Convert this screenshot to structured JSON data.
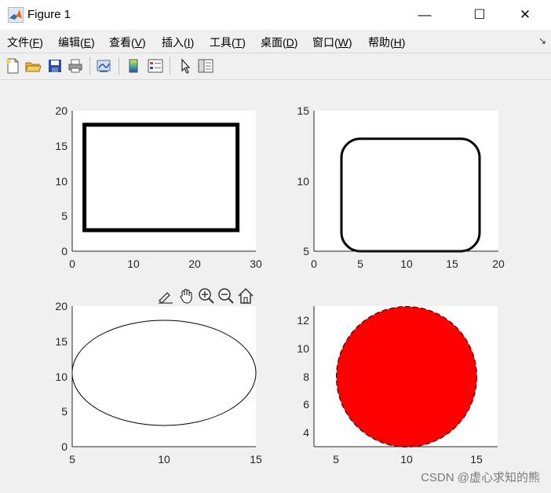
{
  "window": {
    "title": "Figure 1",
    "minimize": "—",
    "maximize": "☐",
    "close": "✕"
  },
  "menu": [
    {
      "label": "文件",
      "key": "F"
    },
    {
      "label": "编辑",
      "key": "E"
    },
    {
      "label": "查看",
      "key": "V"
    },
    {
      "label": "插入",
      "key": "I"
    },
    {
      "label": "工具",
      "key": "T"
    },
    {
      "label": "桌面",
      "key": "D"
    },
    {
      "label": "窗口",
      "key": "W"
    },
    {
      "label": "帮助",
      "key": "H"
    }
  ],
  "toolbar_icons": [
    "new-file-icon",
    "open-folder-icon",
    "save-icon",
    "print-icon",
    "link-plot-icon",
    "colorbar-icon",
    "legend-icon",
    "pointer-icon",
    "property-inspector-icon"
  ],
  "axes_toolbar_icons": [
    "brush-icon",
    "pan-icon",
    "zoom-in-icon",
    "zoom-out-icon",
    "home-icon"
  ],
  "watermark": "CSDN @虚心求知的熊",
  "chart_data": [
    {
      "type": "line",
      "shape": "rectangle",
      "x": [
        2,
        27,
        27,
        2,
        2
      ],
      "y": [
        3,
        3,
        18,
        18,
        3
      ],
      "xlim": [
        0,
        30
      ],
      "ylim": [
        0,
        20
      ],
      "xticks": [
        "0",
        "10",
        "20",
        "30"
      ],
      "yticks": [
        "0",
        "5",
        "10",
        "15",
        "20"
      ],
      "line_color": "#000000",
      "line_style": "thick solid"
    },
    {
      "type": "line",
      "shape": "rounded rectangle",
      "position": [
        3,
        5,
        15,
        8
      ],
      "xlim": [
        0,
        20
      ],
      "ylim": [
        5,
        15
      ],
      "xticks": [
        "0",
        "5",
        "10",
        "15",
        "20"
      ],
      "yticks": [
        "5",
        "10",
        "15"
      ],
      "line_color": "#000000",
      "line_style": "solid"
    },
    {
      "type": "line",
      "shape": "ellipse",
      "center": [
        10,
        10.5
      ],
      "radii": [
        5,
        7.5
      ],
      "xlim": [
        5,
        15
      ],
      "ylim": [
        0,
        20
      ],
      "xticks": [
        "5",
        "10",
        "15"
      ],
      "yticks": [
        "0",
        "5",
        "10",
        "15",
        "20"
      ],
      "line_color": "#000000",
      "line_style": "thin solid"
    },
    {
      "type": "area",
      "shape": "circle",
      "center": [
        10,
        8
      ],
      "radius": 5,
      "xlim": [
        3.5,
        16.5
      ],
      "ylim": [
        3,
        13
      ],
      "xticks": [
        "5",
        "10",
        "15"
      ],
      "yticks": [
        "4",
        "6",
        "8",
        "10",
        "12"
      ],
      "fill_color": "#ff0000",
      "edge_color": "#000000",
      "line_style": "dashed"
    }
  ]
}
